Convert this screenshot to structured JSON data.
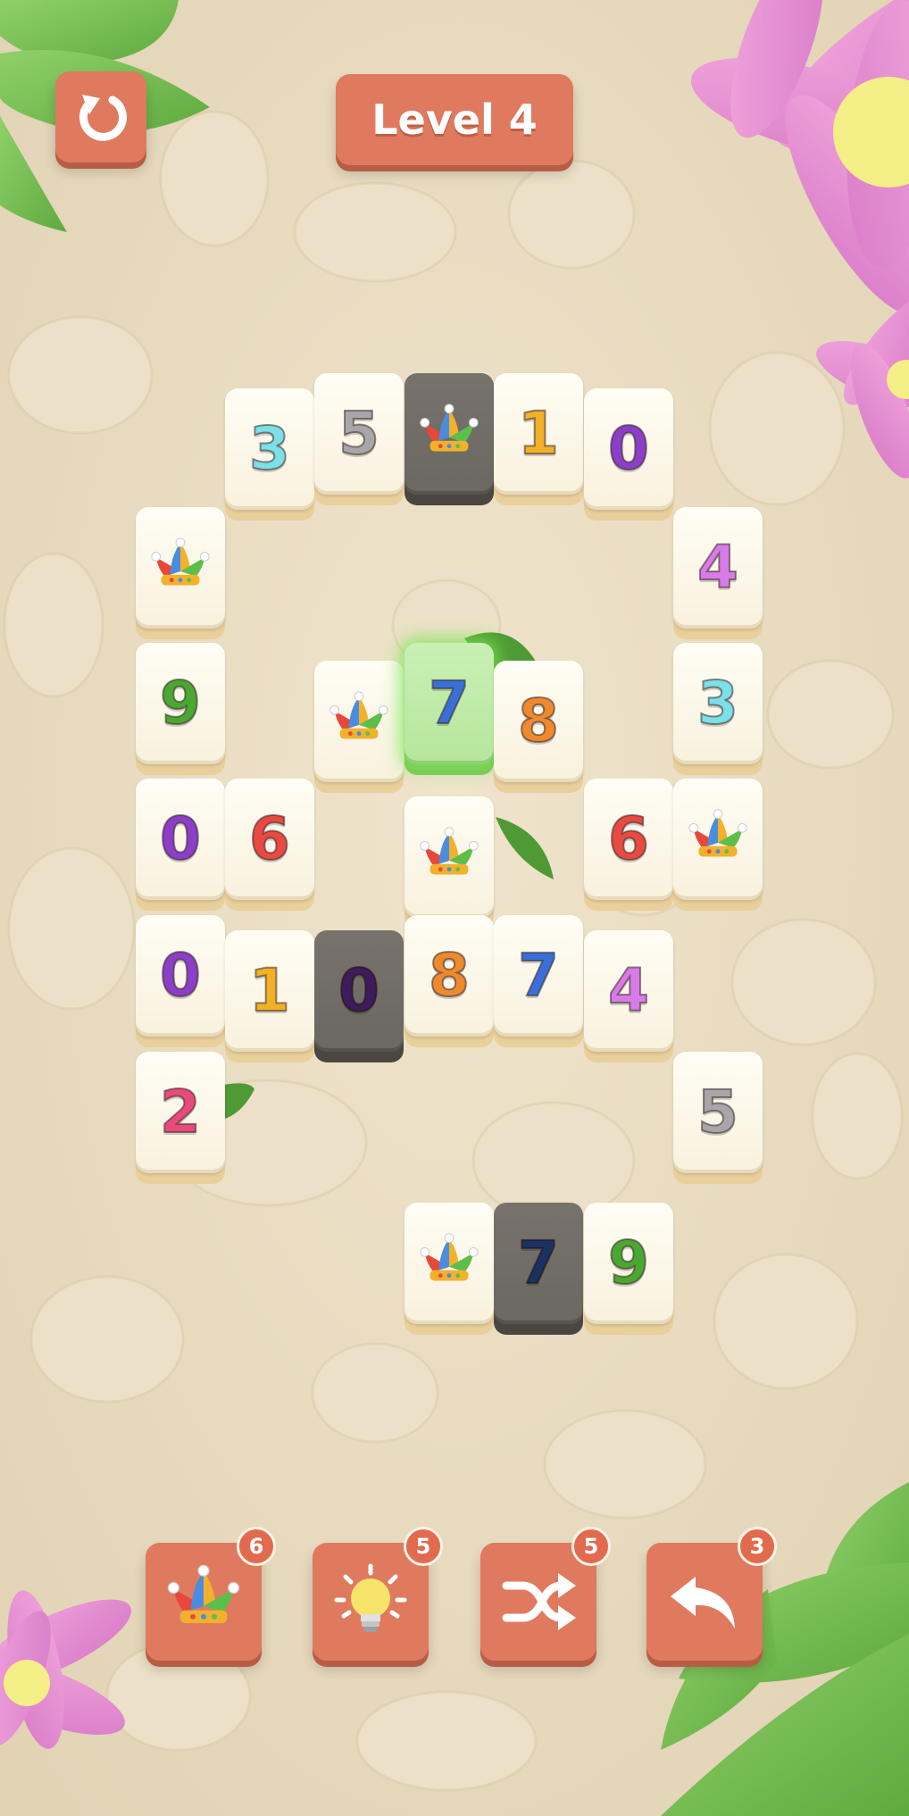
{
  "header": {
    "title": "Level 4",
    "restart_icon": "restart-icon"
  },
  "colors": {
    "background": "#e8dcc4",
    "button": "#df7a5e",
    "badge": "#e26a4e",
    "tile_face": "#fffaed",
    "tile_dark": "#6f6b65",
    "tile_selected": "#b9e8a0"
  },
  "tile_colors": {
    "0": "#8a3fc6",
    "1": "#f0b028",
    "2": "#e84a7c",
    "3": "#7be0e8",
    "4": "#d77be6",
    "5": "#a8a6a8",
    "6": "#e84a42",
    "7": "#3b6fd8",
    "8": "#ee8a2e",
    "9": "#4aa830"
  },
  "board": {
    "tiles": [
      {
        "label": "3",
        "state": "normal"
      },
      {
        "label": "5",
        "state": "normal"
      },
      {
        "label": "",
        "icon": "jester-hat-icon",
        "state": "dark"
      },
      {
        "label": "1",
        "state": "normal"
      },
      {
        "label": "0",
        "state": "normal"
      },
      {
        "label": "",
        "icon": "jester-hat-icon",
        "state": "normal"
      },
      {
        "label": "4",
        "state": "normal"
      },
      {
        "label": "9",
        "state": "normal"
      },
      {
        "label": "",
        "icon": "jester-hat-icon",
        "state": "normal"
      },
      {
        "label": "7",
        "state": "selected"
      },
      {
        "label": "8",
        "state": "normal"
      },
      {
        "label": "3",
        "state": "normal"
      },
      {
        "label": "0",
        "state": "normal"
      },
      {
        "label": "6",
        "state": "normal"
      },
      {
        "label": "",
        "icon": "jester-hat-icon",
        "state": "normal"
      },
      {
        "label": "6",
        "state": "normal"
      },
      {
        "label": "",
        "icon": "jester-hat-icon",
        "state": "normal"
      },
      {
        "label": "0",
        "state": "normal"
      },
      {
        "label": "1",
        "state": "normal"
      },
      {
        "label": "0",
        "state": "dark"
      },
      {
        "label": "8",
        "state": "normal"
      },
      {
        "label": "7",
        "state": "normal"
      },
      {
        "label": "4",
        "state": "normal"
      },
      {
        "label": "2",
        "state": "normal"
      },
      {
        "label": "5",
        "state": "normal"
      },
      {
        "label": "",
        "icon": "jester-hat-icon",
        "state": "normal"
      },
      {
        "label": "7",
        "state": "dark"
      },
      {
        "label": "9",
        "state": "normal"
      }
    ]
  },
  "powerups": [
    {
      "name": "joker",
      "icon": "jester-hat-icon",
      "count": "6"
    },
    {
      "name": "hint",
      "icon": "lightbulb-icon",
      "count": "5"
    },
    {
      "name": "shuffle",
      "icon": "shuffle-icon",
      "count": "5"
    },
    {
      "name": "undo",
      "icon": "undo-arrow-icon",
      "count": "3"
    }
  ]
}
